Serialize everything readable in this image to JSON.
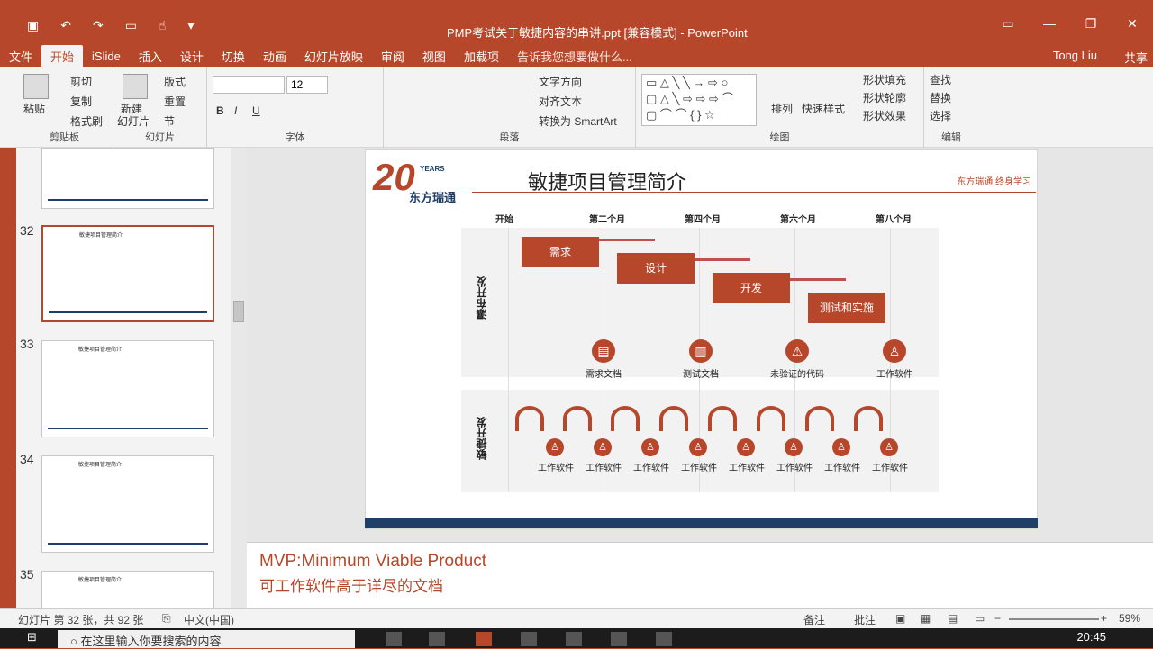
{
  "window": {
    "title": "PMP考试关于敏捷内容的串讲.ppt [兼容模式] - PowerPoint",
    "user": "Tong Liu",
    "share": "共享"
  },
  "tabs": [
    "文件",
    "开始",
    "iSlide",
    "插入",
    "设计",
    "切换",
    "动画",
    "幻灯片放映",
    "审阅",
    "视图",
    "加载项"
  ],
  "tell_me": "告诉我您想要做什么...",
  "ribbon": {
    "paste": "粘贴",
    "cut": "剪切",
    "copy": "复制",
    "format_painter": "格式刷",
    "clipboard": "剪贴板",
    "new_slide": "新建",
    "new_slide2": "幻灯片",
    "layout": "版式",
    "reset": "重置",
    "section": "节",
    "slides_group": "幻灯片",
    "font_size": "12",
    "font_group": "字体",
    "text_direction": "文字方向",
    "align_text": "对齐文本",
    "smartart": "转换为 SmartArt",
    "paragraph_group": "段落",
    "arrange": "排列",
    "quick_styles": "快速样式",
    "shape_fill": "形状填充",
    "shape_outline": "形状轮廓",
    "shape_effects": "形状效果",
    "drawing_group": "绘图",
    "find": "查找",
    "replace": "替换",
    "select": "选择",
    "editing_group": "编辑"
  },
  "thumbnails": [
    {
      "num": "",
      "title": ""
    },
    {
      "num": "32",
      "title": "敏捷项目管理简介"
    },
    {
      "num": "33",
      "title": "敏捷项目管理简介"
    },
    {
      "num": "34",
      "title": "敏捷项目管理简介"
    },
    {
      "num": "35",
      "title": "敏捷项目管理简介"
    }
  ],
  "slide": {
    "logo_number": "20",
    "logo_years": "YEARS",
    "logo_cn": "东方瑞通",
    "title": "敏捷项目管理简介",
    "tagline": "东方瑞通  终身学习",
    "months": [
      "开始",
      "第二个月",
      "第四个月",
      "第六个月",
      "第八个月"
    ],
    "waterfall_label": "瀑布开发",
    "agile_label": "敏捷开发",
    "steps": [
      "需求",
      "设计",
      "开发",
      "测试和实施"
    ],
    "artifacts": [
      "需求文档",
      "测试文档",
      "未验证的代码",
      "工作软件"
    ],
    "working_software": "工作软件"
  },
  "notes": {
    "line1": "MVP:Minimum Viable Product",
    "line2": "可工作软件高于详尽的文档"
  },
  "status": {
    "slide_info": "幻灯片 第 32 张，共 92 张",
    "language": "中文(中国)",
    "notes_btn": "备注",
    "comments_btn": "批注",
    "zoom": "59%"
  },
  "taskbar": {
    "search_placeholder": "在这里输入你要搜索的内容",
    "time": "20:45"
  }
}
